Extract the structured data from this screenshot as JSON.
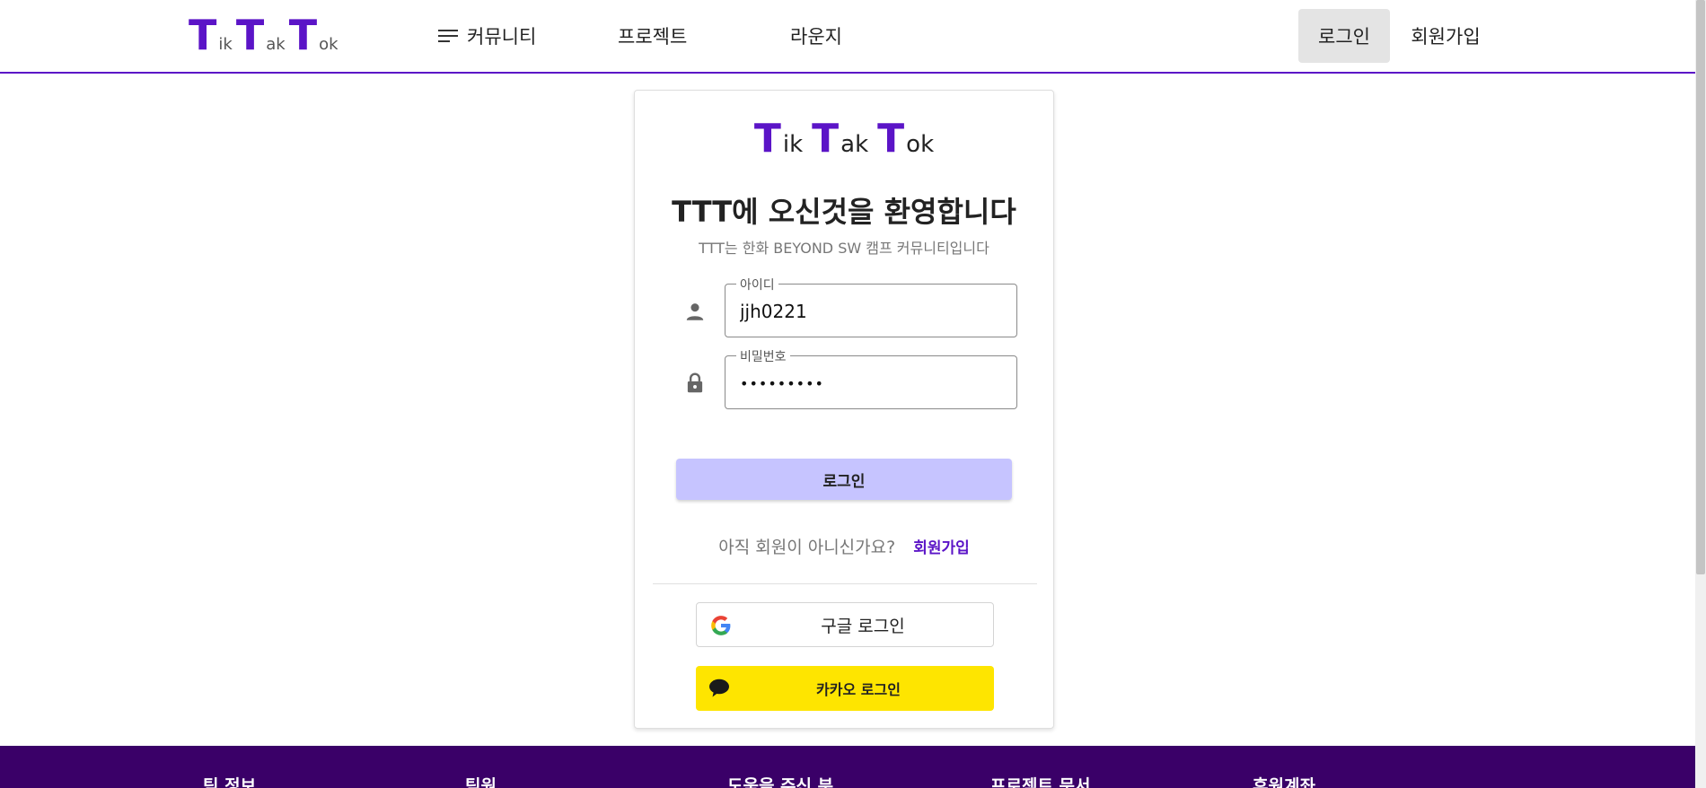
{
  "header": {
    "brand": [
      "T",
      "ik",
      "T",
      "ak",
      "T",
      "ok"
    ],
    "nav": {
      "community": "커뮤니티",
      "project": "프로젝트",
      "lounge": "라운지"
    },
    "login_label": "로그인",
    "signup_label": "회원가입"
  },
  "card": {
    "brand": [
      "T",
      "ik",
      "T",
      "ak",
      "T",
      "ok"
    ],
    "title": "TTT에 오신것을 환영합니다",
    "subtitle": "TTT는 한화 BEYOND SW 캠프 커뮤니티입니다",
    "id_field": {
      "label": "아이디",
      "value": "jjh0221"
    },
    "password_field": {
      "label": "비밀번호",
      "value": "•••••••••"
    },
    "login_button": "로그인",
    "signup_question": "아직 회원이 아니신가요?",
    "signup_link": "회원가입",
    "google_button": "구글 로그인",
    "kakao_button": "카카오 로그인"
  },
  "footer": {
    "columns": [
      "팀 정보",
      "팀원",
      "도움을 주신 분",
      "프로젝트 문서",
      "후원계좌"
    ]
  },
  "colors": {
    "brand_purple": "#5b14c7",
    "footer_bg": "#3a0068",
    "login_button_bg": "#c6c4ff",
    "kakao_yellow": "#fee500"
  },
  "icons": {
    "nav_menu": "menu-lines-icon",
    "id": "person-icon",
    "password": "lock-icon",
    "google": "google-g-icon",
    "kakao": "speech-bubble-icon"
  }
}
